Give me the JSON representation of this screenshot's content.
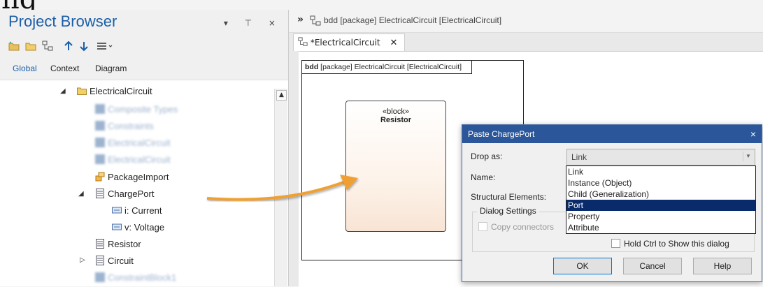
{
  "cropped_top_text": "ng",
  "project_browser": {
    "title": "Project Browser",
    "header_controls": "▾ ⊤ ×",
    "tabs": [
      "Global",
      "Context",
      "Diagram"
    ],
    "tree": [
      {
        "label": "ElectricalCircuit",
        "icon": "folder-icon"
      },
      {
        "label": "Composite Types",
        "icon": "diagram-icon",
        "blurred": true
      },
      {
        "label": "Constraints",
        "icon": "diagram-icon",
        "blurred": true
      },
      {
        "label": "ElectricalCircuit",
        "icon": "diagram-icon",
        "blurred": true
      },
      {
        "label": "ElectricalCircuit",
        "icon": "diagram-icon",
        "blurred": true
      },
      {
        "label": "PackageImport",
        "icon": "package-import-icon"
      },
      {
        "label": "ChargePort",
        "icon": "block-icon"
      },
      {
        "label": "i: Current",
        "icon": "property-icon"
      },
      {
        "label": "v: Voltage",
        "icon": "property-icon"
      },
      {
        "label": "Resistor",
        "icon": "block-icon"
      },
      {
        "label": "Circuit",
        "icon": "block-icon"
      },
      {
        "label": "ConstraintBlock1",
        "icon": "block-icon",
        "blurred": true
      }
    ]
  },
  "diagram": {
    "path_text": "bdd [package] ElectricalCircuit [ElectricalCircuit]",
    "tab_label": "*ElectricalCircuit",
    "frame_label_bold": "bdd",
    "frame_label_rest": " [package] ElectricalCircuit [ElectricalCircuit]",
    "block_stereotype": "«block»",
    "block_name": "Resistor"
  },
  "dialog": {
    "title": "Paste ChargePort",
    "close": "×",
    "drop_as_label": "Drop as:",
    "drop_as_value": "Link",
    "name_label": "Name:",
    "structural_label": "Structural Elements:",
    "options": [
      "Link",
      "Instance (Object)",
      "Child (Generalization)",
      "Port",
      "Property",
      "Attribute"
    ],
    "selected_option": "Port",
    "group_label": "Dialog Settings",
    "copy_connectors": "Copy connectors",
    "hold_ctrl": "Hold Ctrl to Show this dialog",
    "ok": "OK",
    "cancel": "Cancel",
    "help": "Help"
  },
  "colors": {
    "title_blue": "#1d5fa8",
    "dialog_title_bar": "#2b579a",
    "selected_option_bg": "#0a2b6b",
    "drag_arrow": "#f0a030"
  }
}
